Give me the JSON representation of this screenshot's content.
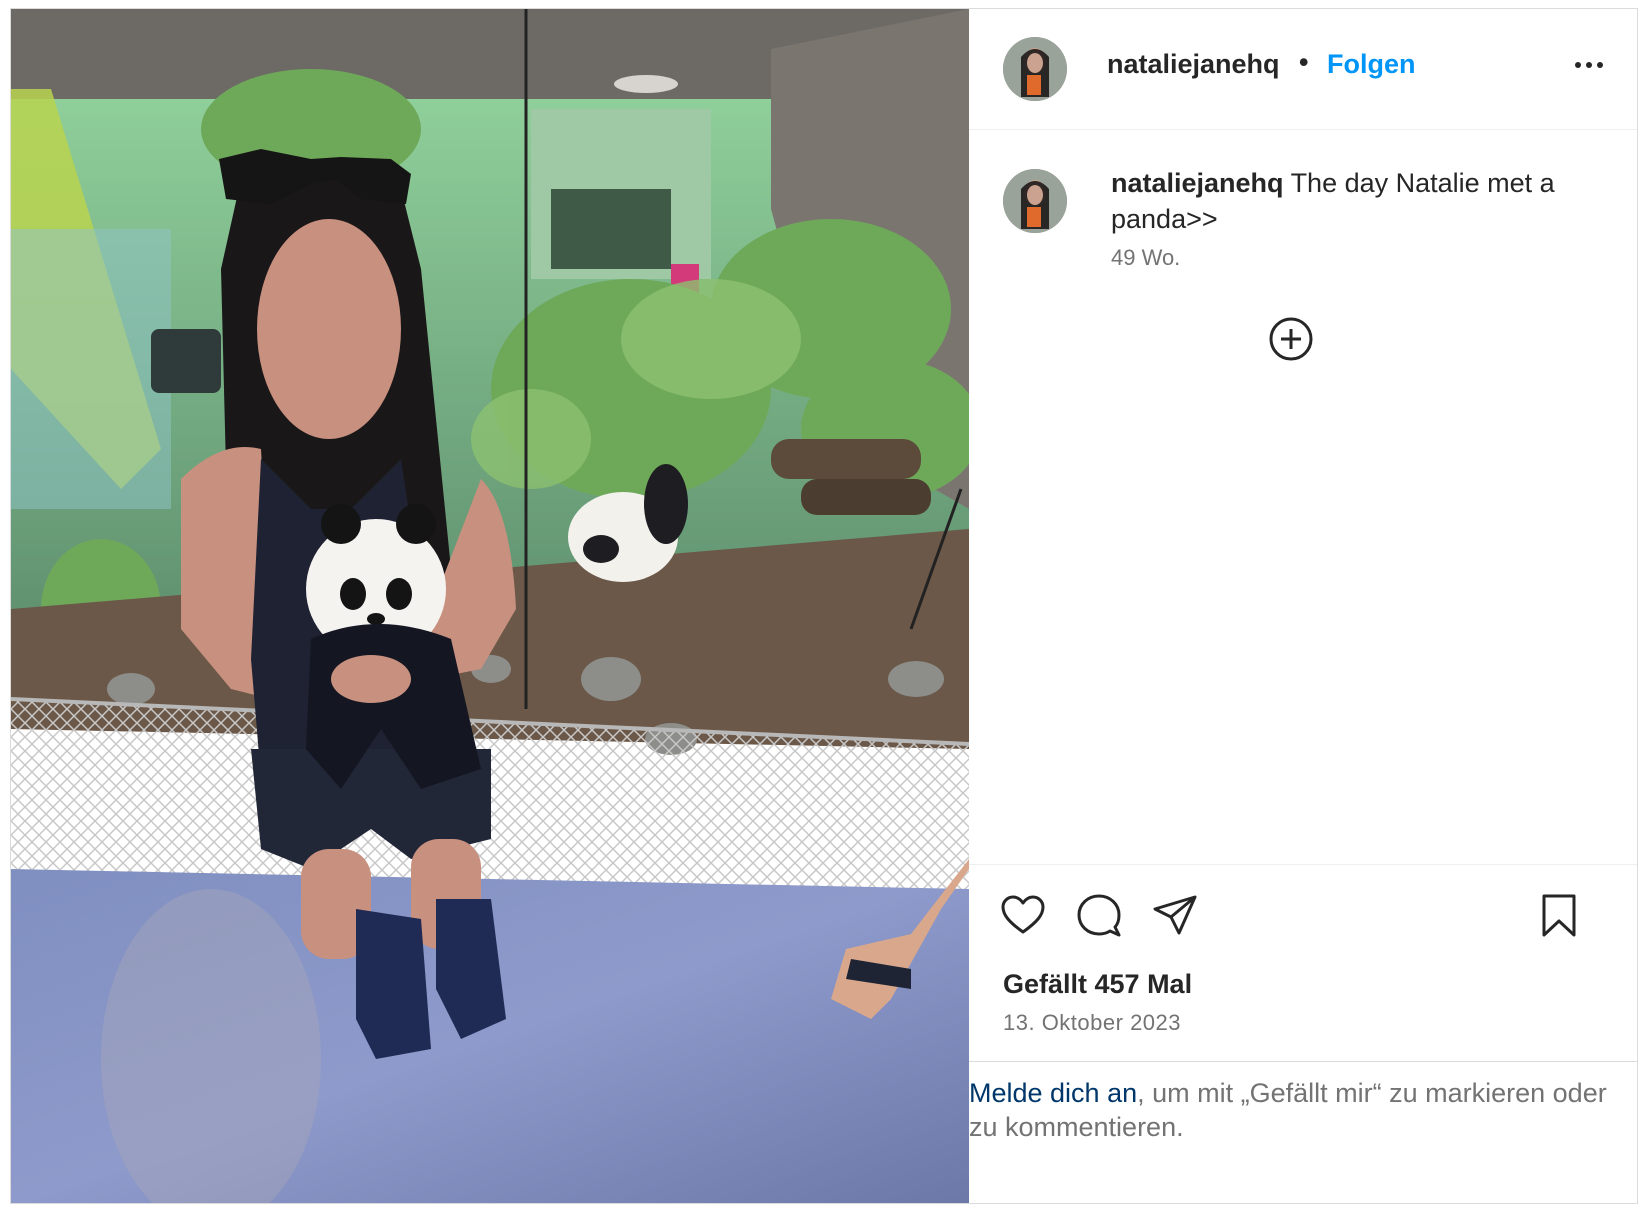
{
  "post": {
    "username": "nataliejanehq",
    "separator": "•",
    "follow_label": "Folgen",
    "more_icon": "more-horizontal-icon",
    "caption": "The day Natalie met a panda>>",
    "time_ago": "49 Wo.",
    "likes": "Gefällt 457 Mal",
    "date": "13. Oktober 2023"
  },
  "login_prompt": {
    "link": "Melde dich an",
    "text": ", um mit „Gefällt mir“ zu markieren oder zu kommentieren."
  },
  "icons": {
    "like": "heart-icon",
    "comment": "comment-bubble-icon",
    "share": "paper-plane-icon",
    "save": "bookmark-icon",
    "add": "plus-circle-icon"
  },
  "colors": {
    "link_blue": "#0095f6",
    "login_link": "#00376b",
    "text": "#262626",
    "muted": "#737373"
  }
}
